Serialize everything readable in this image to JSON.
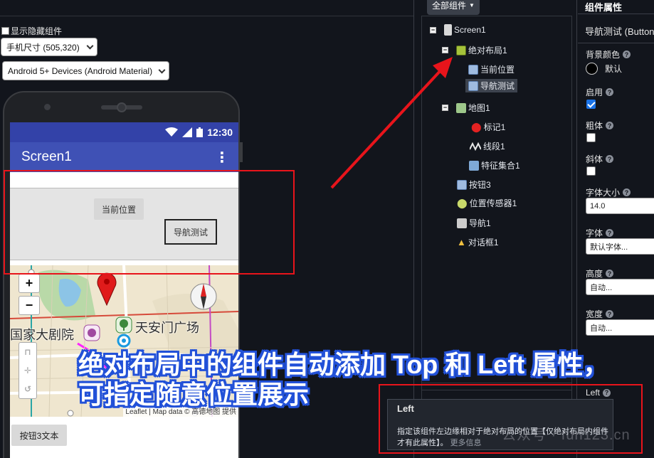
{
  "viewer": {
    "show_hidden_label": "显示隐藏组件",
    "size_select": "手机尺寸 (505,320)",
    "theme_select": "Android 5+ Devices (Android Material)"
  },
  "phone": {
    "status_time": "12:30",
    "screen_title": "Screen1",
    "btn_current_position": "当前位置",
    "btn_nav_test": "导航测试",
    "zoom_in": "+",
    "zoom_out": "−",
    "map_label_1": "国家大剧院",
    "map_label_2": "天安门广场",
    "map_attribution": "Leaflet | Map data © 高德地图 提供",
    "btn3_text": "按钮3文本"
  },
  "caption": {
    "line1": "绝对布局中的组件自动添加 Top 和 Left 属性，",
    "line2": "可指定随意位置展示"
  },
  "tree": {
    "dropdown": "全部组件",
    "items": [
      {
        "label": "Screen1",
        "icon_color": "#d8d8d8"
      },
      {
        "label": "绝对布局1",
        "icon_color": "#a5c23a"
      },
      {
        "label": "当前位置",
        "icon_color": "#9fbbe0"
      },
      {
        "label": "导航测试",
        "icon_color": "#9fbbe0"
      },
      {
        "label": "地图1",
        "icon_color": "#9dc78a"
      },
      {
        "label": "标记1",
        "icon_color": "#e32222"
      },
      {
        "label": "线段1",
        "icon_color": "#222222"
      },
      {
        "label": "特征集合1",
        "icon_color": "#7fa9d6"
      },
      {
        "label": "按钮3",
        "icon_color": "#9fbbe0"
      },
      {
        "label": "位置传感器1",
        "icon_color": "#c8d96a"
      },
      {
        "label": "导航1",
        "icon_color": "#cccccc"
      },
      {
        "label": "对话框1",
        "icon_color": "#f0c040"
      }
    ],
    "collapse_glyph": "−"
  },
  "props": {
    "header": "组件属性",
    "component": "导航测试 (Button)",
    "bg_color_label": "背景颜色",
    "bg_color_value": "默认",
    "enabled_label": "启用",
    "bold_label": "粗体",
    "italic_label": "斜体",
    "font_size_label": "字体大小",
    "font_size_value": "14.0",
    "font_label": "字体",
    "font_value": "默认字体...",
    "height_label": "高度",
    "height_value": "自动...",
    "width_label": "宽度",
    "width_value": "自动...",
    "left_label": "Left",
    "help_glyph": "?"
  },
  "tooltip": {
    "title": "Left",
    "desc": "指定该组件左边缘相对于绝对布局的位置【仅绝对布局内组件才有此属性】。",
    "more": "更多信息"
  },
  "watermark": "公众号 · fun123.cn",
  "colors": {
    "accent_red": "#e8141b",
    "caption_outline": "#2251d8",
    "appbar": "#3f51b5"
  }
}
